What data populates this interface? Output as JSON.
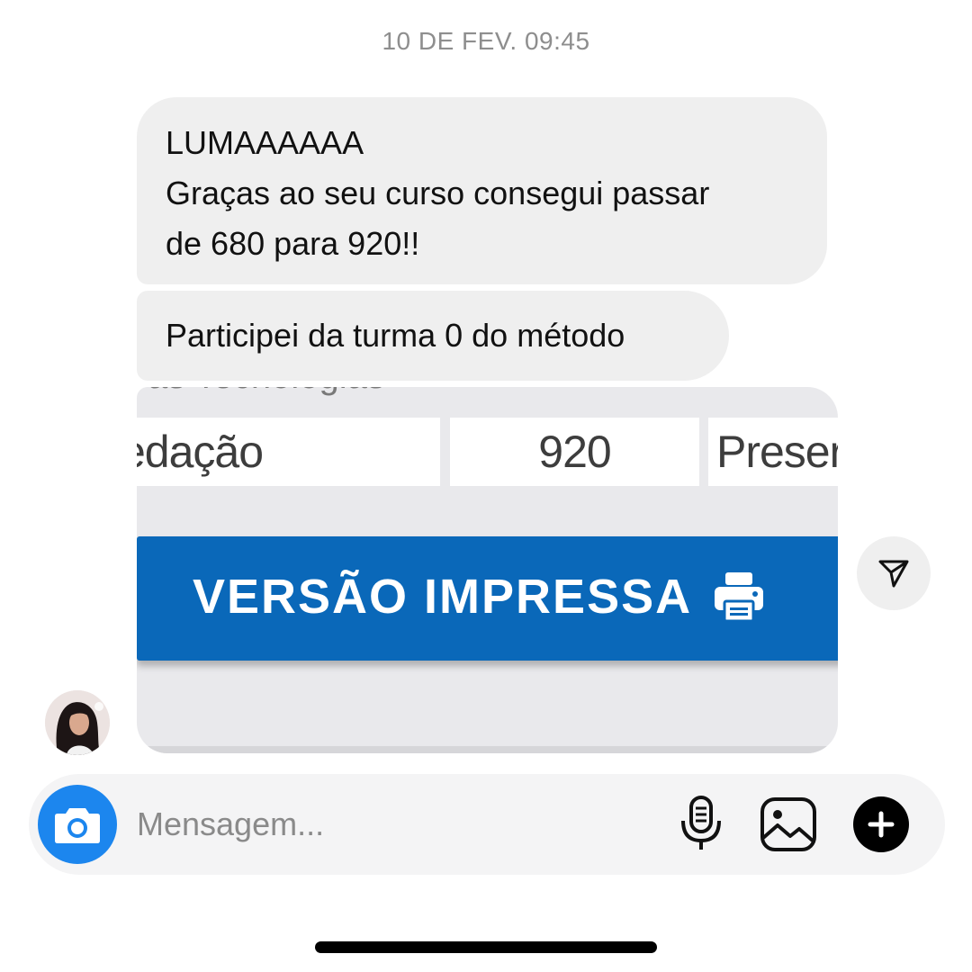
{
  "thread": {
    "timestamp": "10 DE FEV. 09:45"
  },
  "messages": [
    {
      "lines": [
        "LUMAAAAAA",
        "Graças ao seu curso consegui passar",
        "de 680 para 920!!"
      ]
    },
    {
      "text": "Participei da turma 0 do método"
    }
  ],
  "attachment": {
    "cutoff_text": "as Tecnologias",
    "table": {
      "subject": "edação",
      "score": "920",
      "status": "Preser"
    },
    "print_button_label": "VERSÃO IMPRESSA",
    "print_icon": "printer-icon",
    "button_color": "#0a68b9"
  },
  "share": {
    "icon": "send-icon"
  },
  "sender": {
    "avatar": "profile-photo"
  },
  "composer": {
    "placeholder": "Mensagem...",
    "value": "",
    "camera_icon": "camera-icon",
    "mic_icon": "microphone-icon",
    "gallery_icon": "image-icon",
    "add_icon": "plus-icon",
    "camera_color": "#1c86ee"
  }
}
